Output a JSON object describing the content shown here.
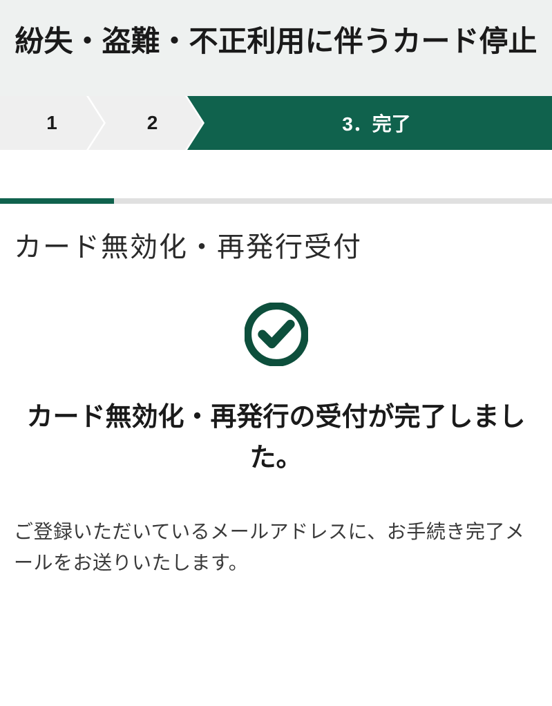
{
  "header": {
    "title": "紛失・盗難・不正利用に伴うカード停止"
  },
  "stepper": {
    "step1": "1",
    "step2": "2",
    "step3": "3．完了"
  },
  "section": {
    "title": "カード無効化・再発行受付"
  },
  "completion": {
    "message": "カード無効化・再発行の受付が完了しました。"
  },
  "description": {
    "text": "ご登録いただいているメールアドレスに、お手続き完了メールをお送りいたします。"
  }
}
